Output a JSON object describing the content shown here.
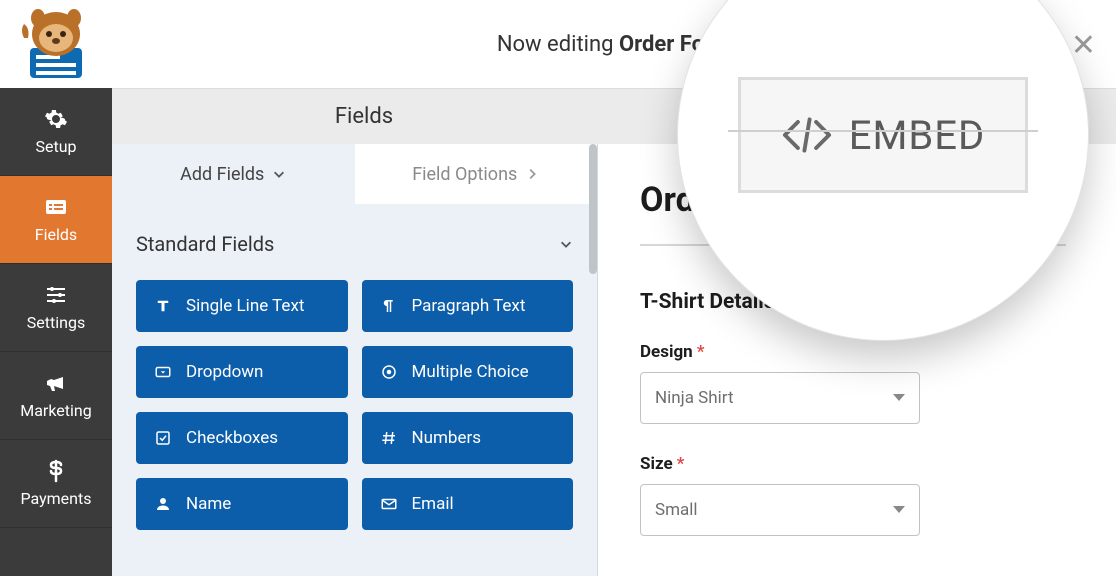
{
  "header": {
    "editing_prefix": "Now editing ",
    "editing_title": "Order Form",
    "subheader_title": "Fields"
  },
  "nav": {
    "items": [
      {
        "id": "setup",
        "label": "Setup"
      },
      {
        "id": "fields",
        "label": "Fields"
      },
      {
        "id": "settings",
        "label": "Settings"
      },
      {
        "id": "marketing",
        "label": "Marketing"
      },
      {
        "id": "payments",
        "label": "Payments"
      }
    ],
    "active": "fields"
  },
  "panel": {
    "tabs": {
      "add": "Add Fields",
      "options": "Field Options"
    },
    "group_title": "Standard Fields",
    "fields": [
      {
        "label": "Single Line Text",
        "icon": "text-icon"
      },
      {
        "label": "Paragraph Text",
        "icon": "paragraph-icon"
      },
      {
        "label": "Dropdown",
        "icon": "dropdown-icon"
      },
      {
        "label": "Multiple Choice",
        "icon": "radio-icon"
      },
      {
        "label": "Checkboxes",
        "icon": "checkbox-icon"
      },
      {
        "label": "Numbers",
        "icon": "hash-icon"
      },
      {
        "label": "Name",
        "icon": "user-icon"
      },
      {
        "label": "Email",
        "icon": "envelope-icon"
      }
    ]
  },
  "preview": {
    "title_visible": "Orde",
    "section_title": "T-Shirt Details",
    "design_label": "Design",
    "design_value": "Ninja Shirt",
    "size_label": "Size",
    "size_value": "Small",
    "required_marker": "*"
  },
  "embed": {
    "label": "EMBED"
  }
}
